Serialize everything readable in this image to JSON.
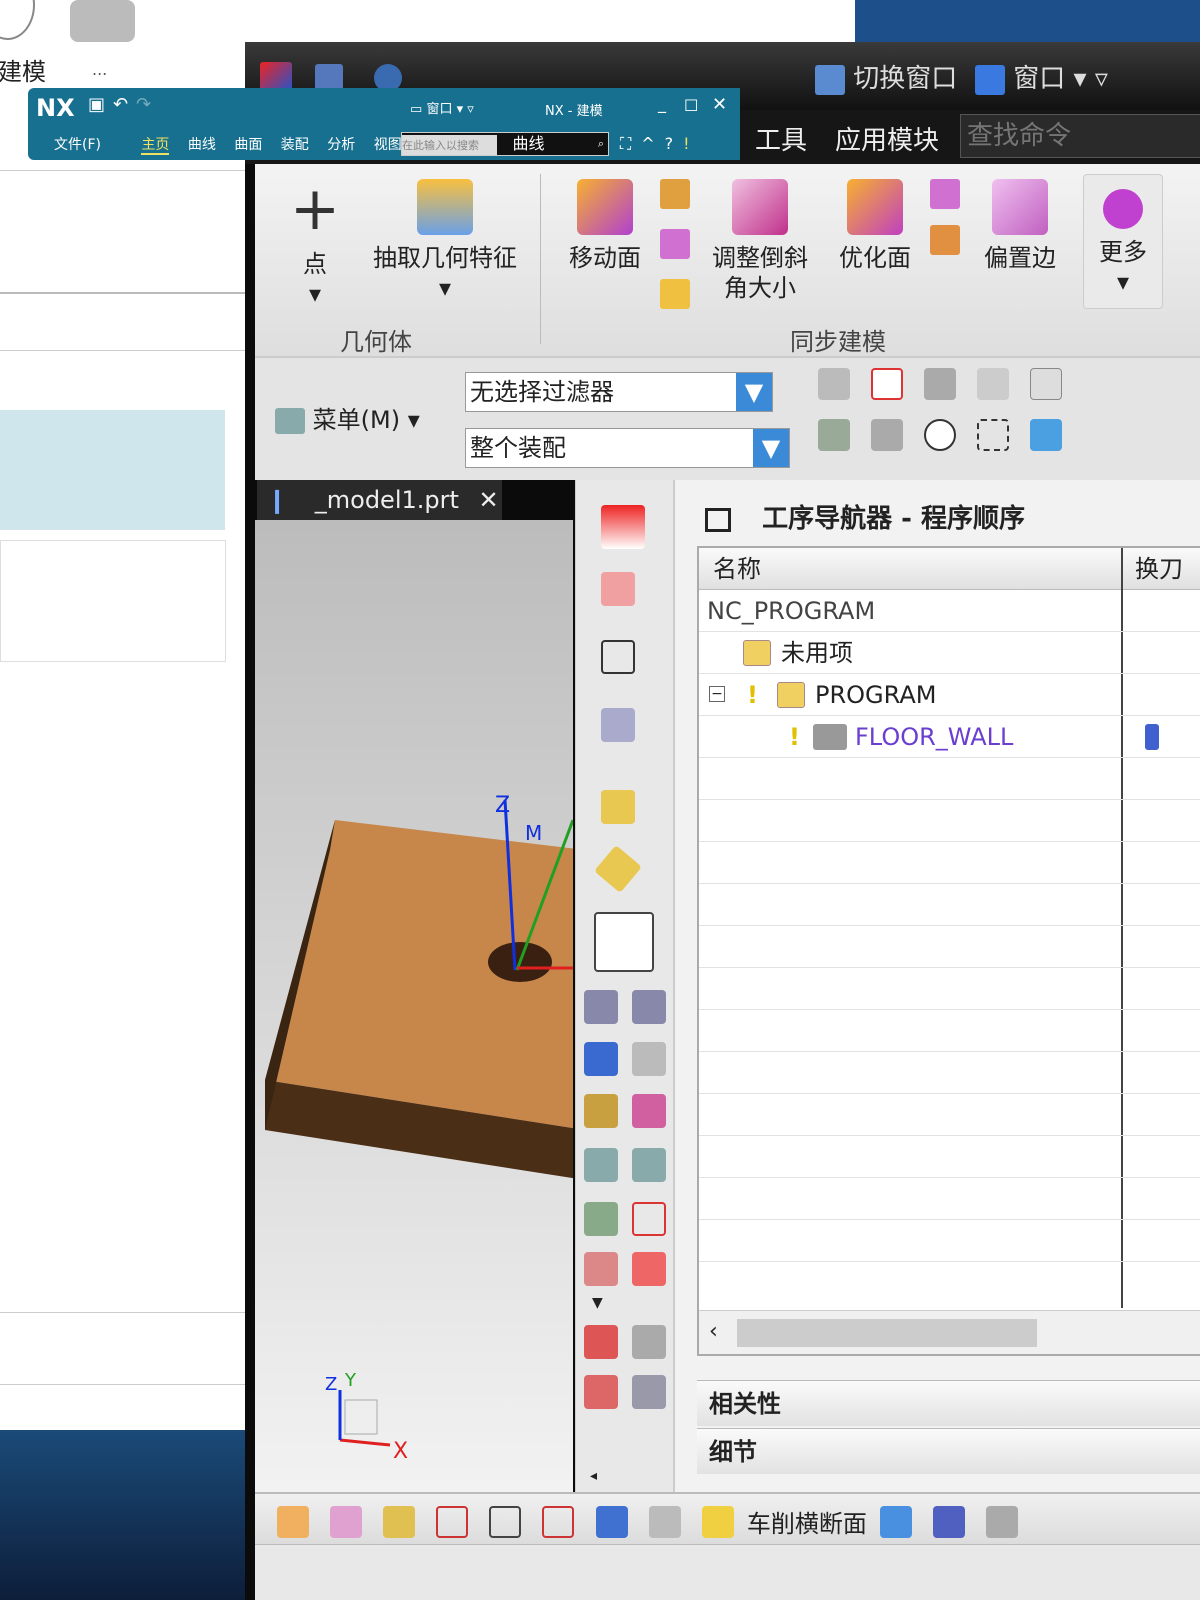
{
  "background_app": {
    "ribbon_label": "建模",
    "more_label": "..."
  },
  "title_bar": {
    "switch_window": "切换窗口",
    "window": "窗口"
  },
  "menu_bar": {
    "items": [
      "工具",
      "应用模块"
    ],
    "search_placeholder": "查找命令"
  },
  "ribbon": {
    "groups": [
      {
        "label": "几何体",
        "buttons": [
          "点",
          "抽取几何特征"
        ]
      },
      {
        "label": "同步建模",
        "buttons": [
          "移动面",
          "调整倒斜角大小",
          "优化面",
          "偏置边",
          "更多"
        ]
      }
    ]
  },
  "selection_bar": {
    "menu": "菜单(M)",
    "filter": "无选择过滤器",
    "scope": "整个装配"
  },
  "viewport": {
    "tab": "_model1.prt",
    "axis_x": "X",
    "axis_y": "Y",
    "axis_z": "Z",
    "csys_labels": [
      "Z",
      "M"
    ]
  },
  "navigator": {
    "title": "工序导航器 - 程序顺序",
    "columns": [
      "名称",
      "换刀"
    ],
    "rows": [
      {
        "name": "NC_PROGRAM",
        "level": 0
      },
      {
        "name": "未用项",
        "level": 1
      },
      {
        "name": "PROGRAM",
        "level": 1
      },
      {
        "name": "FLOOR_WALL",
        "level": 2
      }
    ],
    "panels": [
      "相关性",
      "细节"
    ]
  },
  "bottom_toolbar": {
    "label": "车削横断面"
  },
  "overlay_window": {
    "logo": "NX",
    "window_menu": "窗口",
    "title": "NX - 建模",
    "tabs": [
      "文件(F)",
      "主页",
      "曲线",
      "曲面",
      "装配",
      "分析",
      "视图"
    ],
    "search_placeholder": "在此输入以搜索",
    "search_value": "曲线"
  },
  "colors": {
    "overlay": "#17708f",
    "part": "#c8874a",
    "accent_purple": "#6a3fd0"
  }
}
